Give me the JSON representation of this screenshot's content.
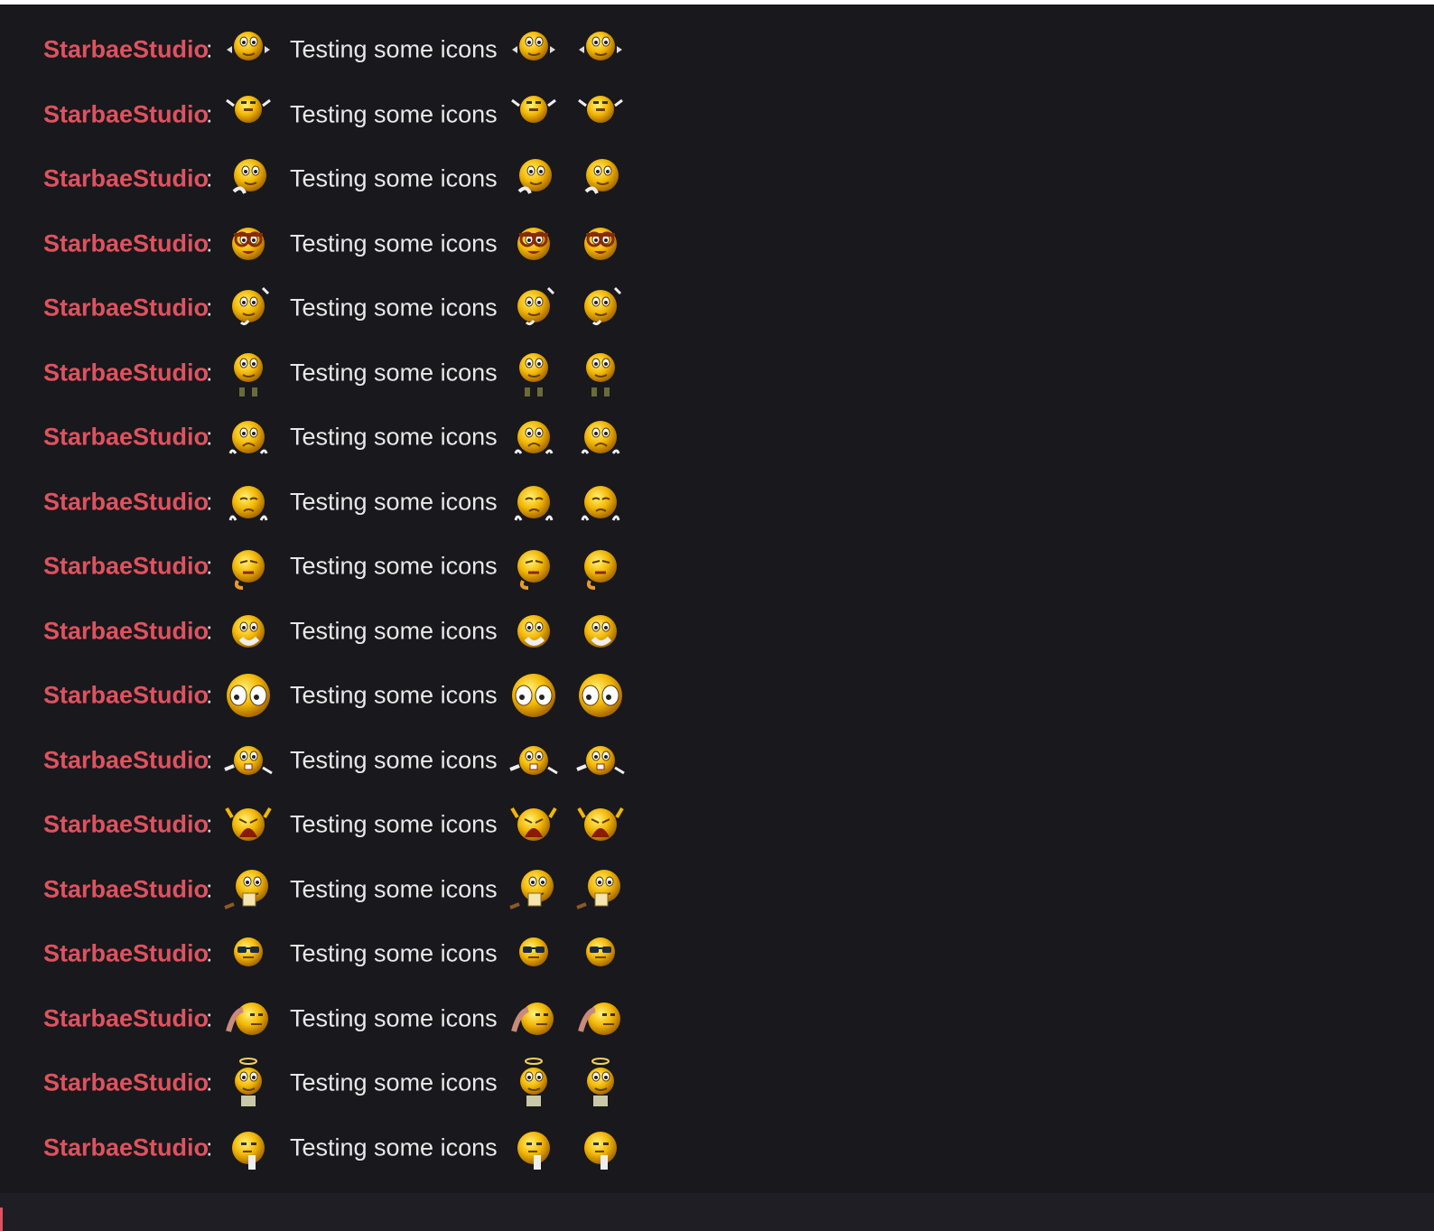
{
  "chat": {
    "messages": [
      {
        "username": "StarbaeStudio",
        "separator": ":",
        "text": "Testing some icons",
        "emote": "stretching-smiley-icon"
      },
      {
        "username": "StarbaeStudio",
        "separator": ":",
        "text": "Testing some icons",
        "emote": "squinting-smiley-icon"
      },
      {
        "username": "StarbaeStudio",
        "separator": ":",
        "text": "Testing some icons",
        "emote": "thinking-smiley-icon"
      },
      {
        "username": "StarbaeStudio",
        "separator": ":",
        "text": "Testing some icons",
        "emote": "nerd-glasses-smiley-icon"
      },
      {
        "username": "StarbaeStudio",
        "separator": ":",
        "text": "Testing some icons",
        "emote": "pondering-smiley-icon"
      },
      {
        "username": "StarbaeStudio",
        "separator": ":",
        "text": "Testing some icons",
        "emote": "skeptical-smiley-icon"
      },
      {
        "username": "StarbaeStudio",
        "separator": ":",
        "text": "Testing some icons",
        "emote": "sad-smiley-icon"
      },
      {
        "username": "StarbaeStudio",
        "separator": ":",
        "text": "Testing some icons",
        "emote": "gloomy-smiley-icon"
      },
      {
        "username": "StarbaeStudio",
        "separator": ":",
        "text": "Testing some icons",
        "emote": "tearful-smiley-icon"
      },
      {
        "username": "StarbaeStudio",
        "separator": ":",
        "text": "Testing some icons",
        "emote": "hand-on-mouth-smiley-icon"
      },
      {
        "username": "StarbaeStudio",
        "separator": ":",
        "text": "Testing some icons",
        "emote": "wide-eyed-smiley-icon"
      },
      {
        "username": "StarbaeStudio",
        "separator": ":",
        "text": "Testing some icons",
        "emote": "shrugging-smiley-icon"
      },
      {
        "username": "StarbaeStudio",
        "separator": ":",
        "text": "Testing some icons",
        "emote": "screaming-smiley-icon"
      },
      {
        "username": "StarbaeStudio",
        "separator": ":",
        "text": "Testing some icons",
        "emote": "reading-smiley-icon"
      },
      {
        "username": "StarbaeStudio",
        "separator": ":",
        "text": "Testing some icons",
        "emote": "sunglasses-smiley-icon"
      },
      {
        "username": "StarbaeStudio",
        "separator": ":",
        "text": "Testing some icons",
        "emote": "facepalm-smiley-icon"
      },
      {
        "username": "StarbaeStudio",
        "separator": ":",
        "text": "Testing some icons",
        "emote": "angel-smiley-icon"
      },
      {
        "username": "StarbaeStudio",
        "separator": ":",
        "text": "Testing some icons",
        "emote": "chin-scratch-smiley-icon"
      }
    ]
  },
  "colors": {
    "background": "#19181c",
    "username": "#e0525f",
    "message_text": "#e8e8ea",
    "input_bar": "#1f1e24"
  }
}
